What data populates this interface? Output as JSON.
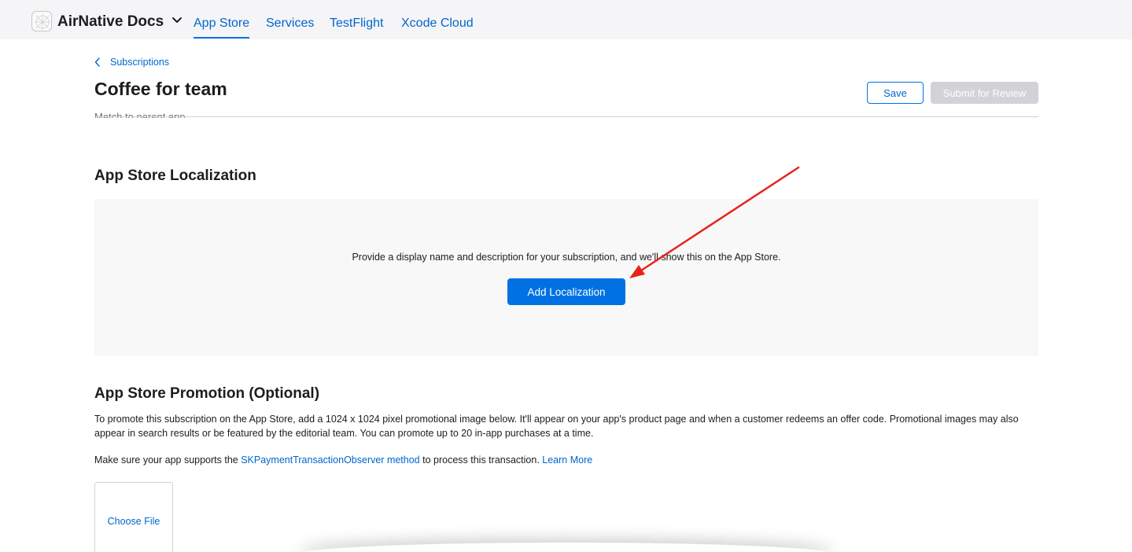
{
  "header": {
    "brand": "AirNative Docs",
    "tabs": [
      {
        "label": "App Store",
        "active": true
      },
      {
        "label": "Services",
        "active": false
      },
      {
        "label": "TestFlight",
        "active": false
      },
      {
        "label": "Xcode Cloud",
        "active": false
      }
    ]
  },
  "breadcrumb": {
    "back_label": "Subscriptions"
  },
  "page": {
    "title": "Coffee for team",
    "save_label": "Save",
    "submit_label": "Submit for Review",
    "partial_text": "Match to parent app"
  },
  "localization": {
    "title": "App Store Localization",
    "message": "Provide a display name and description for your subscription, and we'll show this on the App Store.",
    "add_label": "Add Localization"
  },
  "promotion": {
    "title": "App Store Promotion (Optional)",
    "description": "To promote this subscription on the App Store, add a 1024 x 1024 pixel promotional image below. It'll appear on your app's product page and when a customer redeems an offer code. Promotional images may also appear in search results or be featured by the editorial team. You can promote up to 20 in-app purchases at a time.",
    "note_prefix": "Make sure your app supports the ",
    "note_link": "SKPaymentTransactionObserver method",
    "note_suffix": " to process this transaction. ",
    "learn_more": "Learn More",
    "choose_file": "Choose File"
  },
  "colors": {
    "accent": "#0071e3",
    "link": "#0066cc",
    "annotation_arrow": "#e8221b"
  }
}
